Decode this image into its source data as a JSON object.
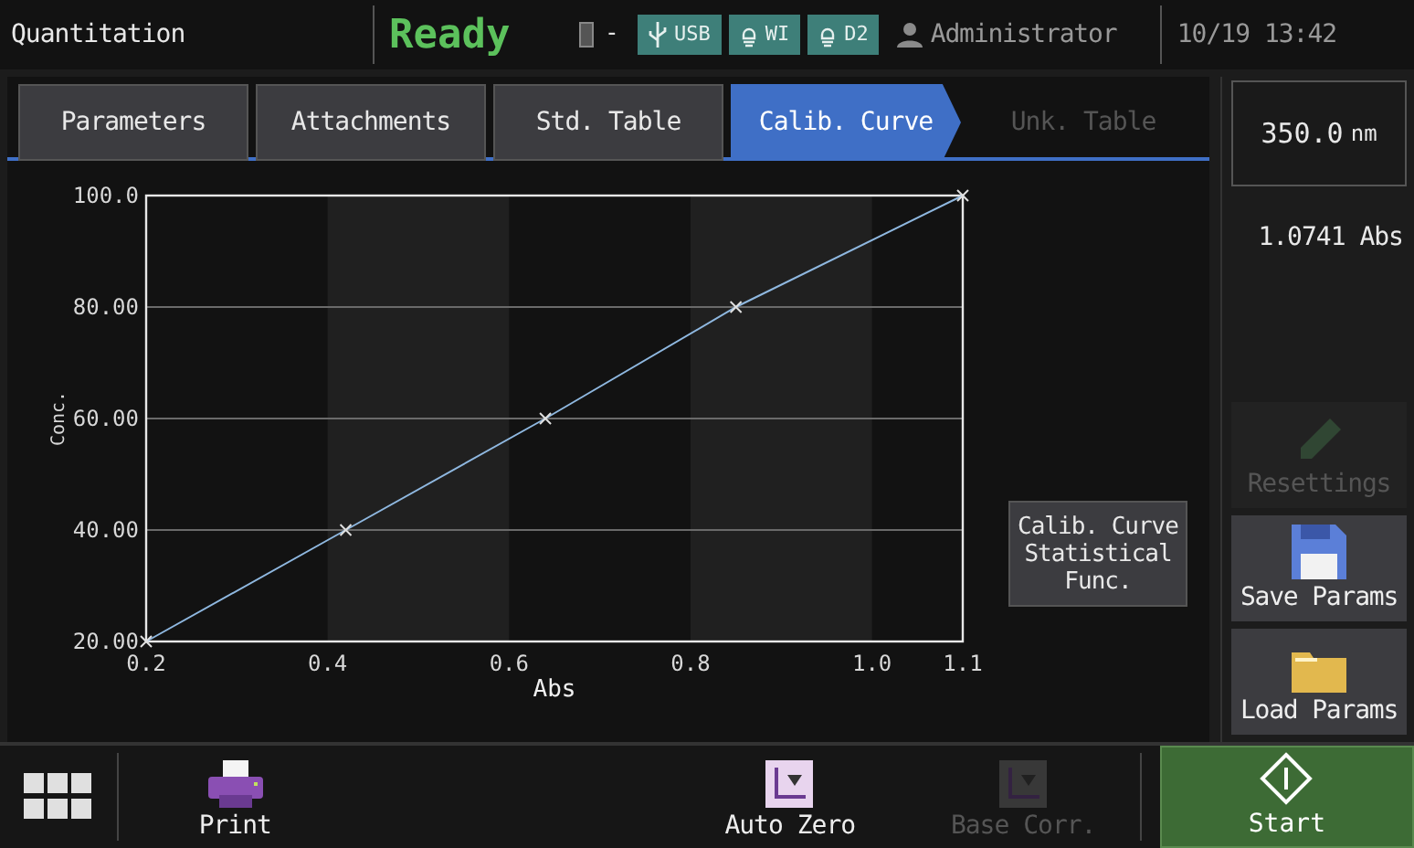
{
  "header": {
    "title": "Quantitation",
    "status": "Ready",
    "lamp_reading": "-",
    "badges": [
      {
        "kind": "usb",
        "label": "USB"
      },
      {
        "kind": "lamp",
        "label": "WI"
      },
      {
        "kind": "lamp",
        "label": "D2"
      }
    ],
    "user": "Administrator",
    "datetime": "10/19 13:42"
  },
  "tabs": [
    {
      "label": "Parameters",
      "selected": false,
      "disabled": false
    },
    {
      "label": "Attachments",
      "selected": false,
      "disabled": false
    },
    {
      "label": "Std. Table",
      "selected": false,
      "disabled": false
    },
    {
      "label": "Calib. Curve",
      "selected": true,
      "disabled": false
    },
    {
      "label": "Unk. Table",
      "selected": false,
      "disabled": true
    }
  ],
  "chart": {
    "chart_data": {
      "type": "line",
      "xlabel": "Abs",
      "ylabel": "Conc.",
      "x": [
        0.2,
        0.42,
        0.64,
        0.85,
        1.1
      ],
      "series": [
        {
          "color": "#8fb8e0",
          "marker": "x",
          "values": [
            20,
            40,
            60,
            80,
            100
          ]
        }
      ],
      "grid": true,
      "xlim": [
        0.2,
        1.1
      ],
      "ylim": [
        20,
        100
      ],
      "xticks": [
        0.2,
        0.4,
        0.6,
        0.8,
        {
          "value": 1.0,
          "label": "1.0"
        },
        1.1
      ],
      "yticks": [
        {
          "value": 20,
          "label": "20.00"
        },
        {
          "value": 40,
          "label": "40.00"
        },
        {
          "value": 60,
          "label": "60.00"
        },
        {
          "value": 80,
          "label": "80.00"
        },
        {
          "value": 100,
          "label": "100.0"
        }
      ]
    },
    "stats_button": "Calib. Curve Statistical Func."
  },
  "side": {
    "wavelength": "350.0",
    "wavelength_unit": "nm",
    "absorbance": "1.0741 Abs",
    "buttons": [
      {
        "kind": "pencil",
        "label": "Resettings",
        "disabled": true
      },
      {
        "kind": "disk",
        "label": "Save Params",
        "disabled": false
      },
      {
        "kind": "folder",
        "label": "Load Params",
        "disabled": false
      }
    ]
  },
  "footer": {
    "buttons": [
      {
        "kind": "printer",
        "label": "Print",
        "disabled": false
      },
      {
        "kind": "autozero",
        "label": "Auto Zero",
        "disabled": false
      },
      {
        "kind": "basecorr",
        "label": "Base Corr.",
        "disabled": true
      }
    ],
    "start": "Start"
  }
}
